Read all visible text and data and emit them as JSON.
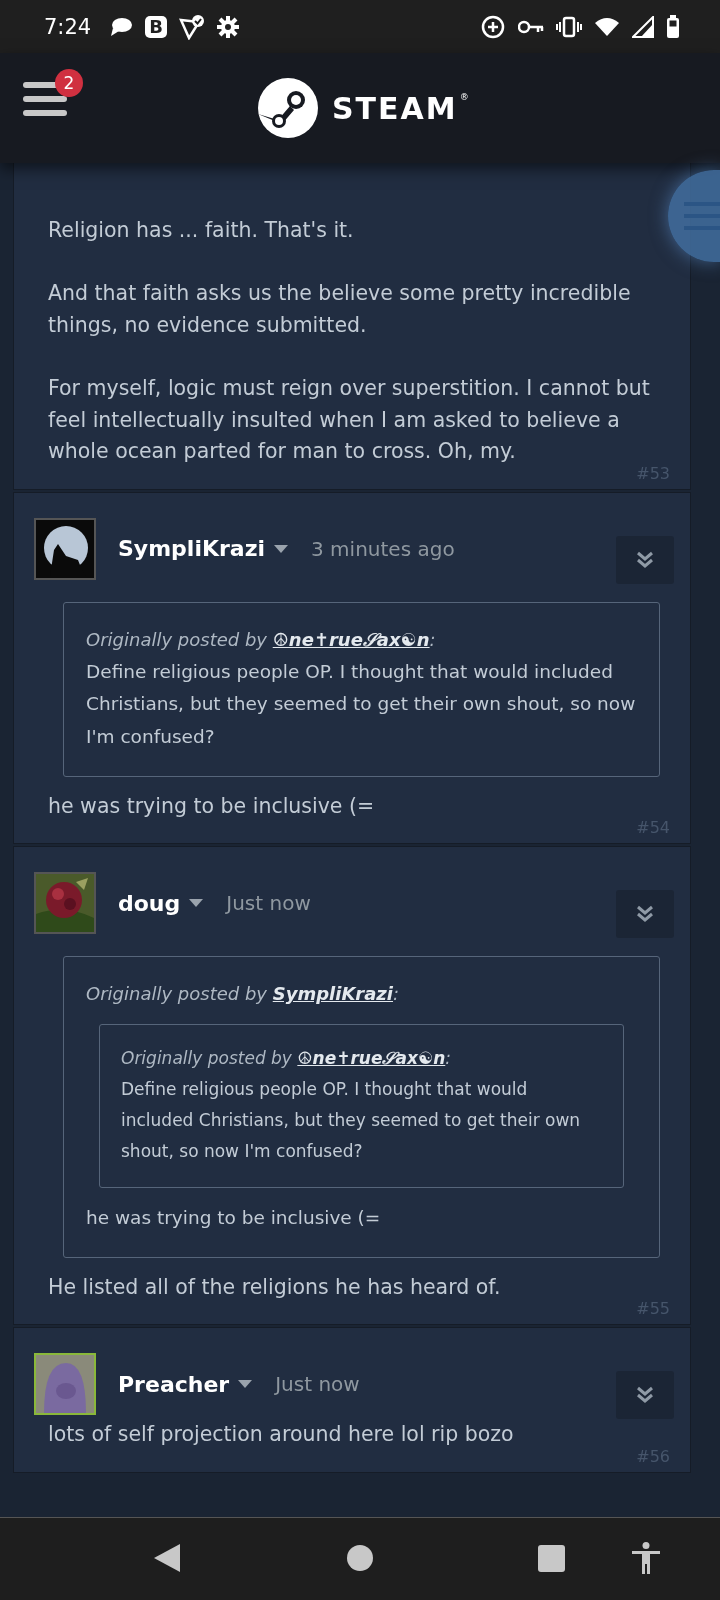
{
  "status_bar": {
    "time": "7:24",
    "notification_icons": [
      {
        "kind": "chat"
      },
      {
        "kind": "letter",
        "text": "B"
      },
      {
        "kind": "check"
      },
      {
        "kind": "gear"
      }
    ],
    "system_icons": [
      {
        "kind": "data_saver"
      },
      {
        "kind": "key"
      },
      {
        "kind": "vibrate"
      },
      {
        "kind": "wifi"
      },
      {
        "kind": "signal"
      },
      {
        "kind": "battery"
      }
    ]
  },
  "header": {
    "menu_badge": "2",
    "logo_text": "STEAM",
    "logo_trademark": "®"
  },
  "posts": [
    {
      "paragraphs": [
        "Religion has ... faith. That's it.",
        "And that faith asks us the believe some pretty incredible things, no evidence submitted.",
        "For myself, logic must reign over superstition. I cannot but feel intellectually insulted when I am asked to believe a whole ocean parted for man to cross. Oh, my."
      ],
      "number": "#53"
    },
    {
      "author": "SympliKrazi",
      "in_game": false,
      "time": "3 minutes ago",
      "quote": {
        "attribution_prefix": "Originally posted by",
        "author": "☮ne✝rue𝒮ax☯n",
        "attribution_suffix": ":",
        "paragraphs": [
          "Define religious people OP. I thought that would included Christians, but they seemed to get their own shout, so now I'm confused?"
        ]
      },
      "paragraphs": [
        "he was trying to be inclusive (="
      ],
      "number": "#54"
    },
    {
      "author": "doug",
      "in_game": false,
      "time": "Just now",
      "quote": {
        "attribution_prefix": "Originally posted by",
        "author": "SympliKrazi",
        "attribution_suffix": ":",
        "quote": {
          "attribution_prefix": "Originally posted by",
          "author": "☮ne✝rue𝒮ax☯n",
          "attribution_suffix": ":",
          "paragraphs": [
            "Define religious people OP. I thought that would included Christians, but they seemed to get their own shout, so now I'm confused?"
          ]
        },
        "paragraphs": [
          "he was trying to be inclusive (="
        ]
      },
      "paragraphs": [
        "He listed all of the religions he has heard of."
      ],
      "number": "#55"
    },
    {
      "author": "Preacher",
      "in_game": true,
      "time": "Just now",
      "paragraphs": [
        "lots of self projection around here lol rip bozo"
      ],
      "number": "#56"
    }
  ]
}
